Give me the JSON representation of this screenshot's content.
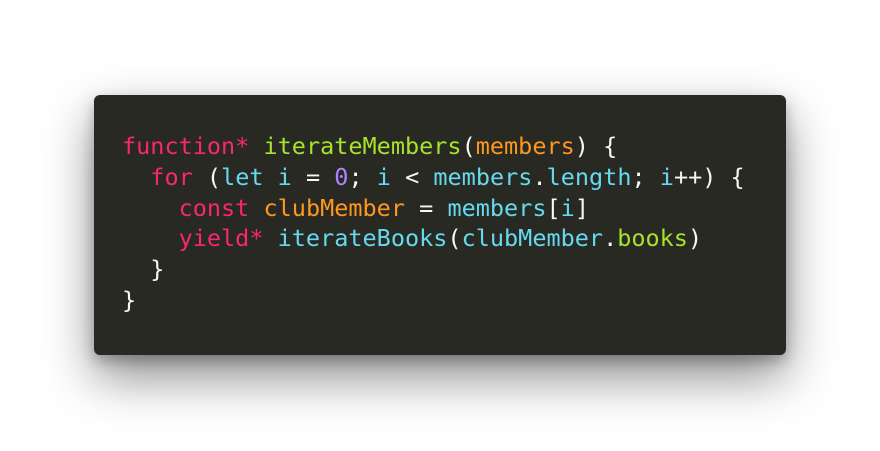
{
  "colors": {
    "background": "#ffffff",
    "editor_background": "#282923",
    "keyword": "#f92672",
    "function_name": "#a6e22e",
    "parameter": "#fd971f",
    "number": "#ae81ff",
    "identifier": "#66d9ef",
    "text": "#f8f8f2"
  },
  "code": {
    "line1": {
      "keyword": "function*",
      "name": "iterateMembers",
      "open_paren": "(",
      "param": "members",
      "close": ") {"
    },
    "line2": {
      "keyword": "for",
      "open": "(",
      "let_kw": "let",
      "var_i": "i",
      "eq": "=",
      "zero": "0",
      "semi1": ";",
      "var_i2": "i",
      "lt": "<",
      "members": "members",
      "dot": ".",
      "length": "length",
      "semi2": ";",
      "var_i3": "i",
      "incr": "++",
      "close": ") {"
    },
    "line3": {
      "keyword": "const",
      "name": "clubMember",
      "eq": "=",
      "members": "members",
      "open_bracket": "[",
      "var_i": "i",
      "close_bracket": "]"
    },
    "line4": {
      "keyword": "yield*",
      "fn": "iterateBooks",
      "open": "(",
      "obj": "clubMember",
      "dot": ".",
      "prop": "books",
      "close": ")"
    },
    "line5": {
      "brace": "}"
    },
    "line6": {
      "brace": "}"
    }
  }
}
